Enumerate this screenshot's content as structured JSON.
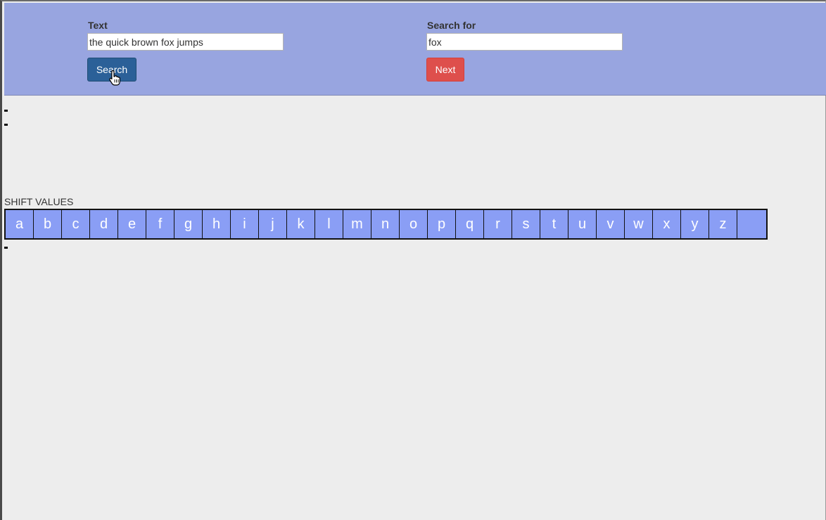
{
  "form": {
    "text_label": "Text",
    "text_value": "the quick brown fox jumps",
    "search_for_label": "Search for",
    "search_for_value": "fox",
    "search_button": "Search",
    "next_button": "Next"
  },
  "shift": {
    "label": "SHIFT VALUES",
    "letters": [
      "a",
      "b",
      "c",
      "d",
      "e",
      "f",
      "g",
      "h",
      "i",
      "j",
      "k",
      "l",
      "m",
      "n",
      "o",
      "p",
      "q",
      "r",
      "s",
      "t",
      "u",
      "v",
      "w",
      "x",
      "y",
      "z",
      ""
    ]
  },
  "colors": {
    "header_bg": "#98a5e0",
    "search_button": "#2b6098",
    "next_button": "#de4f4c",
    "cell_bg": "#8a9ef5"
  },
  "icons": {
    "cursor": "hand-pointer-icon"
  }
}
